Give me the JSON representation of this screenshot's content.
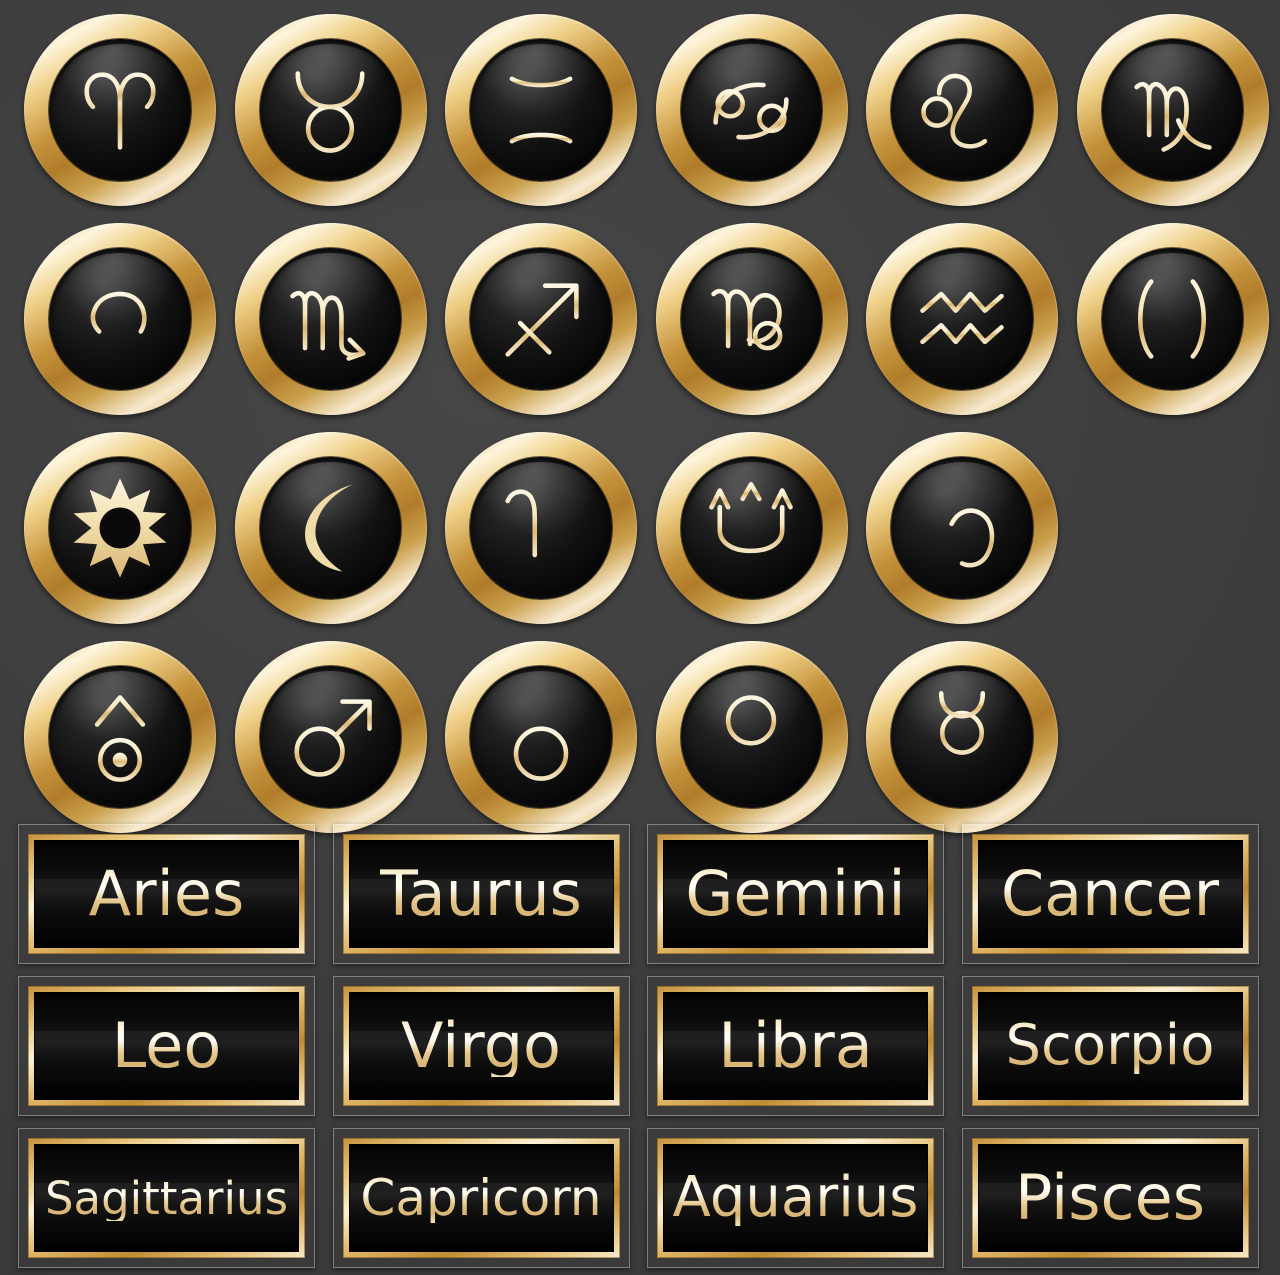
{
  "meta": {
    "title": "Zodiac & Planetary Gold Button Set",
    "background_color": "#3c3c3c",
    "gold_light": "#fdf5dc",
    "gold_mid": "#e0b55e",
    "gold_dark": "#b07c2a",
    "face_color": "#000000",
    "text_gold": "#f3e2bb"
  },
  "buttons": {
    "rows": 4,
    "columns": 6,
    "items": [
      {
        "name": "Aries",
        "icon": "aries-icon",
        "symbol": "♈",
        "row": 1,
        "col": 1
      },
      {
        "name": "Taurus",
        "icon": "taurus-icon",
        "symbol": "♉",
        "row": 1,
        "col": 2
      },
      {
        "name": "Gemini",
        "icon": "gemini-icon",
        "symbol": "♊",
        "row": 1,
        "col": 3
      },
      {
        "name": "Cancer",
        "icon": "cancer-icon",
        "symbol": "♋",
        "row": 1,
        "col": 4
      },
      {
        "name": "Leo",
        "icon": "leo-icon",
        "symbol": "♌",
        "row": 1,
        "col": 5
      },
      {
        "name": "Virgo",
        "icon": "virgo-icon",
        "symbol": "♍",
        "row": 1,
        "col": 6
      },
      {
        "name": "Libra",
        "icon": "libra-icon",
        "symbol": "♎",
        "row": 2,
        "col": 1
      },
      {
        "name": "Scorpio",
        "icon": "scorpio-icon",
        "symbol": "♏",
        "row": 2,
        "col": 2
      },
      {
        "name": "Sagittarius",
        "icon": "sagittarius-icon",
        "symbol": "♐",
        "row": 2,
        "col": 3
      },
      {
        "name": "Capricorn",
        "icon": "capricorn-icon",
        "symbol": "♑",
        "row": 2,
        "col": 4
      },
      {
        "name": "Aquarius",
        "icon": "aquarius-icon",
        "symbol": "♒",
        "row": 2,
        "col": 5
      },
      {
        "name": "Pisces",
        "icon": "pisces-icon",
        "symbol": "♓",
        "row": 2,
        "col": 6
      },
      {
        "name": "Sun",
        "icon": "sun-icon",
        "symbol": "☉",
        "row": 3,
        "col": 1
      },
      {
        "name": "Moon",
        "icon": "moon-icon",
        "symbol": "☽",
        "row": 3,
        "col": 2
      },
      {
        "name": "Jupiter",
        "icon": "jupiter-icon",
        "symbol": "♃",
        "row": 3,
        "col": 3
      },
      {
        "name": "Neptune",
        "icon": "neptune-icon",
        "symbol": "♆",
        "row": 3,
        "col": 4
      },
      {
        "name": "Saturn",
        "icon": "saturn-icon",
        "symbol": "♄",
        "row": 3,
        "col": 5
      },
      {
        "name": "Uranus",
        "icon": "uranus-icon",
        "symbol": "⛢",
        "row": 4,
        "col": 1
      },
      {
        "name": "Mars",
        "icon": "mars-icon",
        "symbol": "♂",
        "row": 4,
        "col": 2
      },
      {
        "name": "Pluto",
        "icon": "pluto-icon",
        "symbol": "♇",
        "row": 4,
        "col": 3
      },
      {
        "name": "Venus",
        "icon": "venus-icon",
        "symbol": "♀",
        "row": 4,
        "col": 4
      },
      {
        "name": "Mercury",
        "icon": "mercury-icon",
        "symbol": "☿",
        "row": 4,
        "col": 5
      }
    ]
  },
  "plaques": {
    "rows": 3,
    "columns": 4,
    "items": [
      {
        "label": "Aries",
        "row": 1,
        "col": 1
      },
      {
        "label": "Taurus",
        "row": 1,
        "col": 2
      },
      {
        "label": "Gemini",
        "row": 1,
        "col": 3
      },
      {
        "label": "Cancer",
        "row": 1,
        "col": 4
      },
      {
        "label": "Leo",
        "row": 2,
        "col": 1
      },
      {
        "label": "Virgo",
        "row": 2,
        "col": 2
      },
      {
        "label": "Libra",
        "row": 2,
        "col": 3
      },
      {
        "label": "Scorpio",
        "row": 2,
        "col": 4
      },
      {
        "label": "Sagittarius",
        "row": 3,
        "col": 1
      },
      {
        "label": "Capricorn",
        "row": 3,
        "col": 2
      },
      {
        "label": "Aquarius",
        "row": 3,
        "col": 3
      },
      {
        "label": "Pisces",
        "row": 3,
        "col": 4
      }
    ]
  }
}
